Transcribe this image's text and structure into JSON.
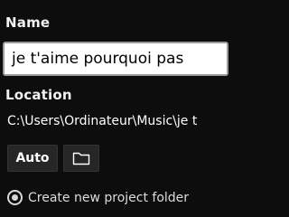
{
  "fields": {
    "name_label": "Name",
    "name_value": "je t'aime pourquoi pas",
    "location_label": "Location",
    "location_path": "C:\\Users\\Ordinateur\\Music\\je t"
  },
  "buttons": {
    "auto_label": "Auto",
    "folder_icon": "folder-icon"
  },
  "options": {
    "create_folder_label": "Create new project folder",
    "create_folder_selected": true
  }
}
